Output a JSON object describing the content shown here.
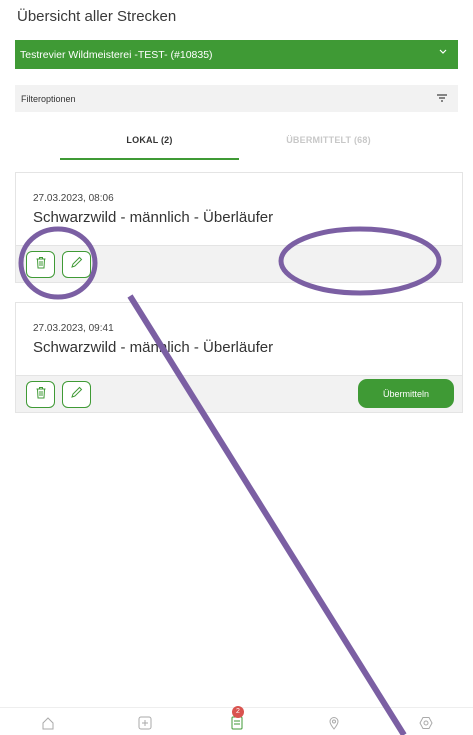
{
  "page": {
    "title": "Übersicht aller Strecken"
  },
  "revier": {
    "selected": "Testrevier Wildmeisterei -TEST- (#10835)"
  },
  "filter": {
    "label": "Filteroptionen"
  },
  "tabs": [
    {
      "label": "LOKAL (2)",
      "active": true
    },
    {
      "label": "ÜBERMITTELT (68)",
      "active": false
    }
  ],
  "records": [
    {
      "date": "27.03.2023, 08:06",
      "title": "Schwarzwild - männlich - Überläufer",
      "send_label": ""
    },
    {
      "date": "27.03.2023, 09:41",
      "title": "Schwarzwild - männlich - Überläufer",
      "send_label": "Übermitteln"
    }
  ],
  "bottom_nav": {
    "items": [
      "home-icon",
      "add-icon",
      "list-icon",
      "location-icon",
      "settings-icon"
    ],
    "badge_count": "2"
  },
  "colors": {
    "accent": "#3f9a35",
    "annotation": "#7b5fa3",
    "badge": "#d9534f"
  }
}
